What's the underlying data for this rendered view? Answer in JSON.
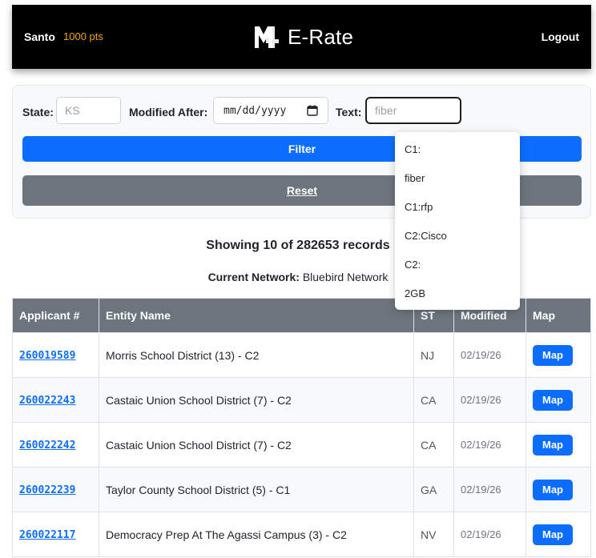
{
  "header": {
    "user_name": "Santo",
    "points": "1000 pts",
    "brand": "E-Rate",
    "logo_icon": "m4-logo",
    "logout_label": "Logout"
  },
  "filters": {
    "state_label": "State:",
    "state_placeholder": "KS",
    "modified_label": "Modified After:",
    "date_placeholder": "mm/dd/yyyy",
    "text_label": "Text:",
    "text_placeholder": "fiber",
    "filter_label": "Filter",
    "reset_label": "Reset"
  },
  "suggestions": [
    "C1:",
    "fiber",
    "C1:rfp",
    "C2:Cisco",
    "C2:",
    "2GB"
  ],
  "summary": {
    "showing": "Showing 10 of 282653 records",
    "network_label": "Current Network:",
    "network_value": "Bluebird Network"
  },
  "table": {
    "headers": [
      "Applicant #",
      "Entity Name",
      "ST",
      "Modified",
      "Map"
    ],
    "rows": [
      {
        "app": "260019589",
        "entity": "Morris School District (13) - C2",
        "st": "NJ",
        "modified": "02/19/26",
        "map": "Map"
      },
      {
        "app": "260022243",
        "entity": "Castaic Union School District (7) - C2",
        "st": "CA",
        "modified": "02/19/26",
        "map": "Map"
      },
      {
        "app": "260022242",
        "entity": "Castaic Union School District (7) - C2",
        "st": "CA",
        "modified": "02/19/26",
        "map": "Map"
      },
      {
        "app": "260022239",
        "entity": "Taylor County School District (5) - C1",
        "st": "GA",
        "modified": "02/19/26",
        "map": "Map"
      },
      {
        "app": "260022117",
        "entity": "Democracy Prep At The Agassi Campus (3) - C2",
        "st": "NV",
        "modified": "02/19/26",
        "map": "Map"
      }
    ]
  },
  "colors": {
    "header_bg": "#000000",
    "points": "#f0a500",
    "primary": "#0d6efd",
    "secondary": "#6c757d"
  }
}
